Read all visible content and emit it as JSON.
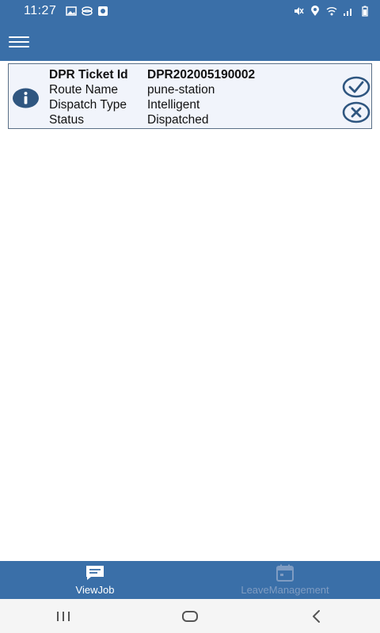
{
  "status_bar": {
    "time": "11:27",
    "left_icons": [
      "image-icon",
      "layers-icon",
      "notification-icon"
    ],
    "right_icons": [
      "mute-icon",
      "location-icon",
      "wifi-icon",
      "signal-icon",
      "battery-icon"
    ]
  },
  "app_bar": {
    "menu_icon": "hamburger-menu-icon"
  },
  "ticket": {
    "id_label": "DPR Ticket Id",
    "id_value": "DPR202005190002",
    "route_label": "Route Name",
    "route_value": "pune-station",
    "dispatch_label": "Dispatch Type",
    "dispatch_value": "Intelligent",
    "status_label": "Status",
    "status_value": "Dispatched"
  },
  "bottom_nav": {
    "items": [
      {
        "label": "ViewJob",
        "icon": "message-icon",
        "active": true
      },
      {
        "label": "LeaveManagement",
        "icon": "calendar-icon",
        "active": false
      }
    ]
  },
  "system_nav": [
    "recents-button",
    "home-button",
    "back-button"
  ],
  "colors": {
    "primary": "#3a6fa8",
    "card_bg": "#f1f4fb",
    "card_border": "#5a6f86",
    "icon_dark": "#2f5680",
    "inactive_nav": "#7f9cc2"
  }
}
